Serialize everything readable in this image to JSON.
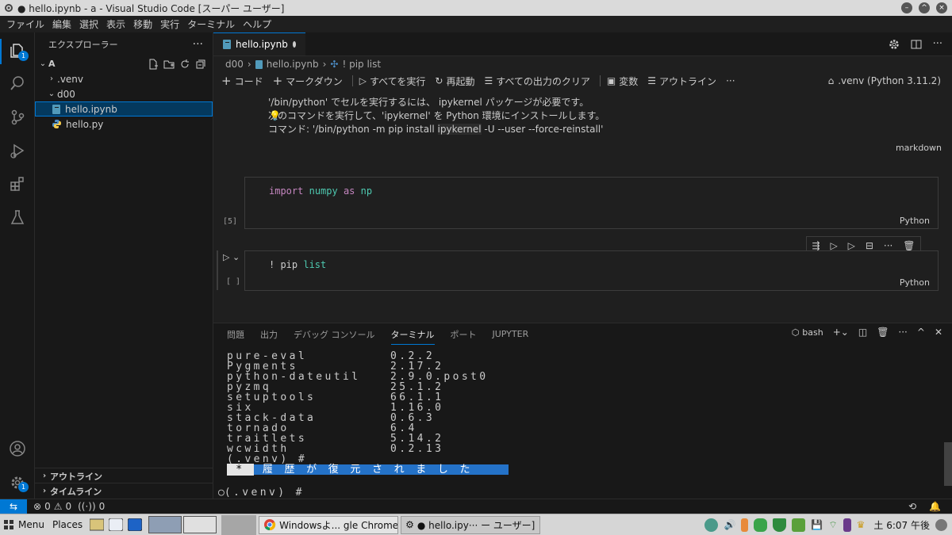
{
  "window": {
    "title": "● hello.ipynb - a - Visual Studio Code [スーパー ユーザー]",
    "buttons": [
      "minimize",
      "maximize",
      "close"
    ]
  },
  "menu": [
    "ファイル",
    "編集",
    "選択",
    "表示",
    "移動",
    "実行",
    "ターミナル",
    "ヘルプ"
  ],
  "activity_bar": {
    "explorer_badge": "1",
    "settings_badge": "1"
  },
  "sidebar": {
    "title": "エクスプローラー",
    "more": "···",
    "root": "A",
    "items": [
      {
        "label": ".venv",
        "kind": "folder-collapsed"
      },
      {
        "label": "d00",
        "kind": "folder-expanded"
      },
      {
        "label": "hello.ipynb",
        "kind": "notebook",
        "selected": true
      },
      {
        "label": "hello.py",
        "kind": "python"
      }
    ],
    "sections": [
      "アウトライン",
      "タイムライン"
    ]
  },
  "editor": {
    "tab": {
      "label": "hello.ipynb",
      "dirty": true
    },
    "breadcrumb": [
      "d00",
      "hello.ipynb",
      "! pip list"
    ],
    "toolbar": {
      "add_code": "コード",
      "add_markdown": "マークダウン",
      "run_all": "すべてを実行",
      "restart": "再起動",
      "clear_outputs": "すべての出力のクリア",
      "variables": "変数",
      "outline": "アウトライン",
      "more": "···",
      "kernel": ".venv (Python 3.11.2)"
    },
    "markdown_cell": {
      "line1": "'/bin/python' でセルを実行するには、 ipykernel パッケージが必要です。",
      "line2": "次のコマンドを実行して、'ipykernel' を Python 環境にインストールします。",
      "line3_prefix": "コマンド: '/bin/python -m pip install ",
      "line3_code": "ipykernel",
      "line3_suffix": " -U --user --force-reinstall'",
      "label": "markdown"
    },
    "code_cells": [
      {
        "exec_count": "[5]",
        "kw1": "import",
        "mod": "numpy",
        "kw2": "as",
        "alias": "np",
        "lang": "Python"
      },
      {
        "exec_count": "[ ]",
        "text1": "! pip ",
        "text2": "list",
        "lang": "Python"
      }
    ]
  },
  "panel": {
    "tabs": [
      "問題",
      "出力",
      "デバッグ コンソール",
      "ターミナル",
      "ポート",
      "JUPYTER"
    ],
    "active_tab": "ターミナル",
    "shell": "bash",
    "terminal_lines": [
      {
        "name": "pure-eval",
        "version": "0.2.2"
      },
      {
        "name": "Pygments",
        "version": "2.17.2"
      },
      {
        "name": "python-dateutil",
        "version": "2.9.0.post0"
      },
      {
        "name": "pyzmq",
        "version": "25.1.2"
      },
      {
        "name": "setuptools",
        "version": "66.1.1"
      },
      {
        "name": "six",
        "version": "1.16.0"
      },
      {
        "name": "stack-data",
        "version": "0.6.3"
      },
      {
        "name": "tornado",
        "version": "6.4"
      },
      {
        "name": "traitlets",
        "version": "5.14.2"
      },
      {
        "name": "wcwidth",
        "version": "0.2.13"
      }
    ],
    "prompt1": "(.venv) #",
    "restore_marker": " * ",
    "restore_text": " 履 歴 が 復 元 さ れ ま し た    ",
    "prompt2": "(.venv) #"
  },
  "statusbar": {
    "errors": "0",
    "warnings": "0",
    "ports": "0"
  },
  "taskbar": {
    "menu": "Menu",
    "places": "Places",
    "windows": [
      {
        "label": "Windowsよ... gle Chrome"
      },
      {
        "label": "● hello.ipy··· ー ユーザー]"
      }
    ],
    "clock": "土  6:07 午後"
  }
}
